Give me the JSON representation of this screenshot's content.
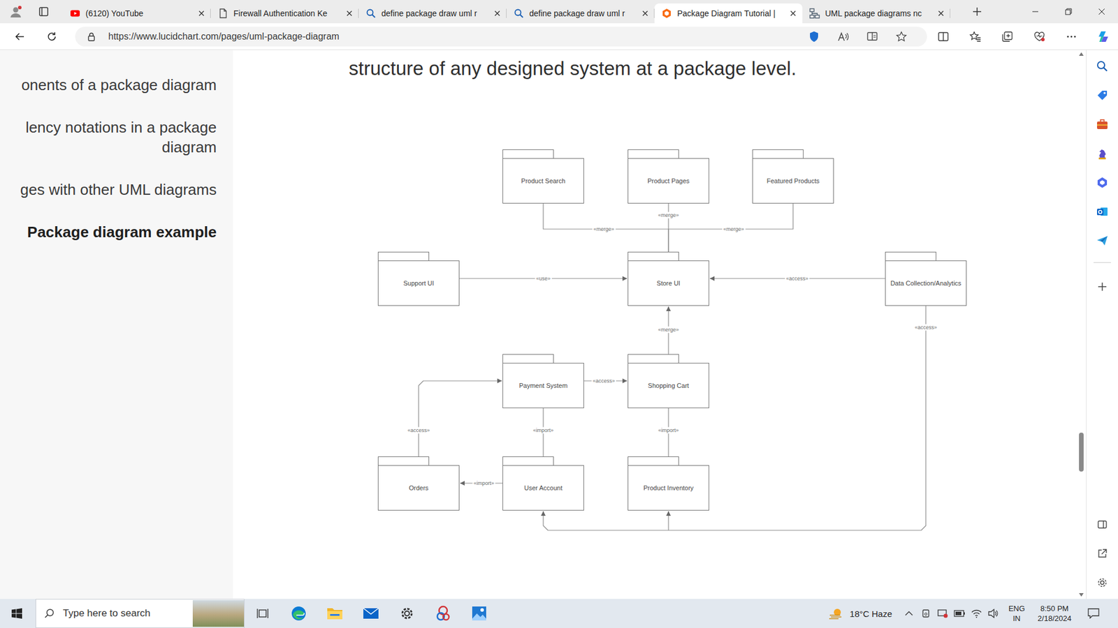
{
  "browser": {
    "tabs": [
      {
        "title": "(6120) YouTube",
        "kind": "youtube",
        "selected": false
      },
      {
        "title": "Firewall Authentication Ke",
        "kind": "page",
        "selected": false
      },
      {
        "title": "define package draw uml r",
        "kind": "search",
        "selected": false
      },
      {
        "title": "define package draw uml r",
        "kind": "search",
        "selected": false
      },
      {
        "title": "Package Diagram Tutorial |",
        "kind": "lucid",
        "selected": true
      },
      {
        "title": "UML package diagrams nc",
        "kind": "uml",
        "selected": false
      }
    ],
    "address": {
      "url": "https://www.lucidchart.com/pages/uml-package-diagram"
    }
  },
  "page": {
    "toc": [
      {
        "label": "onents of a package diagram",
        "selected": false
      },
      {
        "label": "lency notations in a package diagram",
        "selected": false
      },
      {
        "label": "ges with other UML diagrams",
        "selected": false
      },
      {
        "label": "Package diagram example",
        "selected": true
      }
    ],
    "heading": "structure of any designed system at a package level.",
    "diagram": {
      "packages": [
        {
          "name": "Product Search"
        },
        {
          "name": "Product Pages"
        },
        {
          "name": "Featured Products"
        },
        {
          "name": "Support UI"
        },
        {
          "name": "Store UI"
        },
        {
          "name": "Data Collection/Analytics"
        },
        {
          "name": "Payment System"
        },
        {
          "name": "Shopping Cart"
        },
        {
          "name": "Orders"
        },
        {
          "name": "User Account"
        },
        {
          "name": "Product Inventory"
        }
      ],
      "dependencies": [
        {
          "from": "Product Search",
          "to": "Store UI",
          "label": "«merge»"
        },
        {
          "from": "Product Pages",
          "to": "Store UI",
          "label": "«merge»"
        },
        {
          "from": "Featured Products",
          "to": "Store UI",
          "label": "«merge»"
        },
        {
          "from": "Support UI",
          "to": "Store UI",
          "label": "«use»"
        },
        {
          "from": "Data Collection/Analytics",
          "to": "Store UI",
          "label": "«access»"
        },
        {
          "from": "Shopping Cart",
          "to": "Store UI",
          "label": "«merge»"
        },
        {
          "from": "Payment System",
          "to": "Shopping Cart",
          "label": "«access»"
        },
        {
          "from": "Orders",
          "to": "Payment System",
          "label": "«access»"
        },
        {
          "from": "Payment System",
          "to": "User Account",
          "label": "«import»"
        },
        {
          "from": "Shopping Cart",
          "to": "Product Inventory",
          "label": "«import»"
        },
        {
          "from": "User Account",
          "to": "Orders",
          "label": "«import»"
        },
        {
          "from": "Data Collection/Analytics",
          "to": "User Account",
          "label": "«access»"
        },
        {
          "from": "Data Collection/Analytics",
          "to": "Product Inventory"
        }
      ]
    },
    "page_scroll": {
      "level": 0.76
    }
  },
  "taskbar": {
    "search_placeholder": "Type here to search",
    "weather": "18°C Haze",
    "language": [
      "ENG",
      "IN"
    ],
    "clock": {
      "time": "8:50 PM",
      "date": "2/18/2024"
    }
  }
}
